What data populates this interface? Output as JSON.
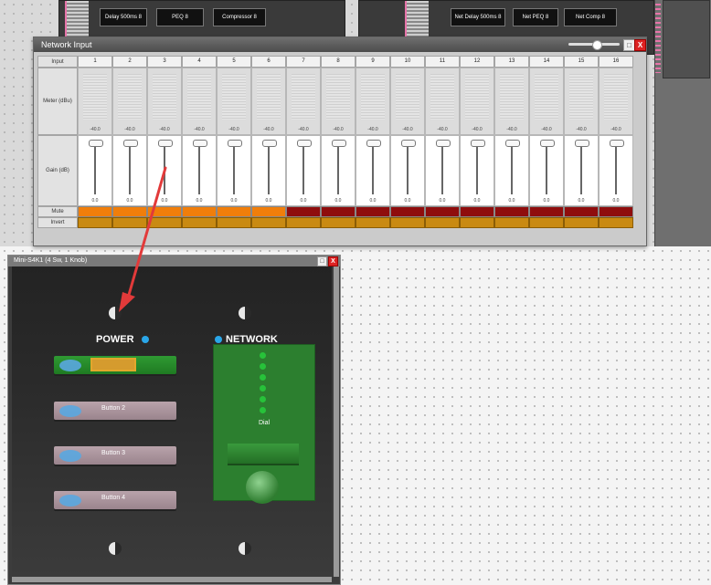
{
  "workspace": {
    "left_modules": [
      "Delay 500ms 8",
      "PEQ 8",
      "Compressor 8"
    ],
    "right_modules": [
      "Net Delay 500ms 8",
      "Net PEQ 8",
      "Net Comp 8"
    ]
  },
  "network_input": {
    "title": "Network Input",
    "header_label": "Input",
    "channels": [
      "1",
      "2",
      "3",
      "4",
      "5",
      "6",
      "7",
      "8",
      "9",
      "10",
      "11",
      "12",
      "13",
      "14",
      "15",
      "16"
    ],
    "meter_label": "Meter (dBu)",
    "meter_values": [
      "-40.0",
      "-40.0",
      "-40.0",
      "-40.0",
      "-40.0",
      "-40.0",
      "-40.0",
      "-40.0",
      "-40.0",
      "-40.0",
      "-40.0",
      "-40.0",
      "-40.0",
      "-40.0",
      "-40.0",
      "-40.0"
    ],
    "gain_label": "Gain (dB)",
    "gain_values": [
      "0.0",
      "0.0",
      "0.0",
      "0.0",
      "0.0",
      "0.0",
      "0.0",
      "0.0",
      "0.0",
      "0.0",
      "0.0",
      "0.0",
      "0.0",
      "0.0",
      "0.0",
      "0.0"
    ],
    "mute_label": "Mute",
    "invert_label": "Invert",
    "mute_colors": [
      "#f07e0b",
      "#f07e0b",
      "#f07e0b",
      "#f07e0b",
      "#f07e0b",
      "#f07e0b",
      "#8f0d0d",
      "#8f0d0d",
      "#8f0d0d",
      "#8f0d0d",
      "#8f0d0d",
      "#8f0d0d",
      "#8f0d0d",
      "#8f0d0d",
      "#8f0d0d",
      "#8f0d0d"
    ],
    "window_buttons": {
      "restore": "□",
      "close": "X"
    }
  },
  "device": {
    "title": "Mini-S4K1 (4 Sw, 1 Knob)",
    "window_buttons": {
      "restore": "□",
      "close": "X"
    },
    "power_label": "POWER",
    "network_label": "NETWORK",
    "buttons": [
      "",
      "Button 2",
      "Button 3",
      "Button 4"
    ],
    "dial_label": "Dial",
    "led_color": "#2aa6e8",
    "accent_green": "#2c7f2f"
  },
  "annotation": {
    "arrow_color": "#e23a3a"
  }
}
